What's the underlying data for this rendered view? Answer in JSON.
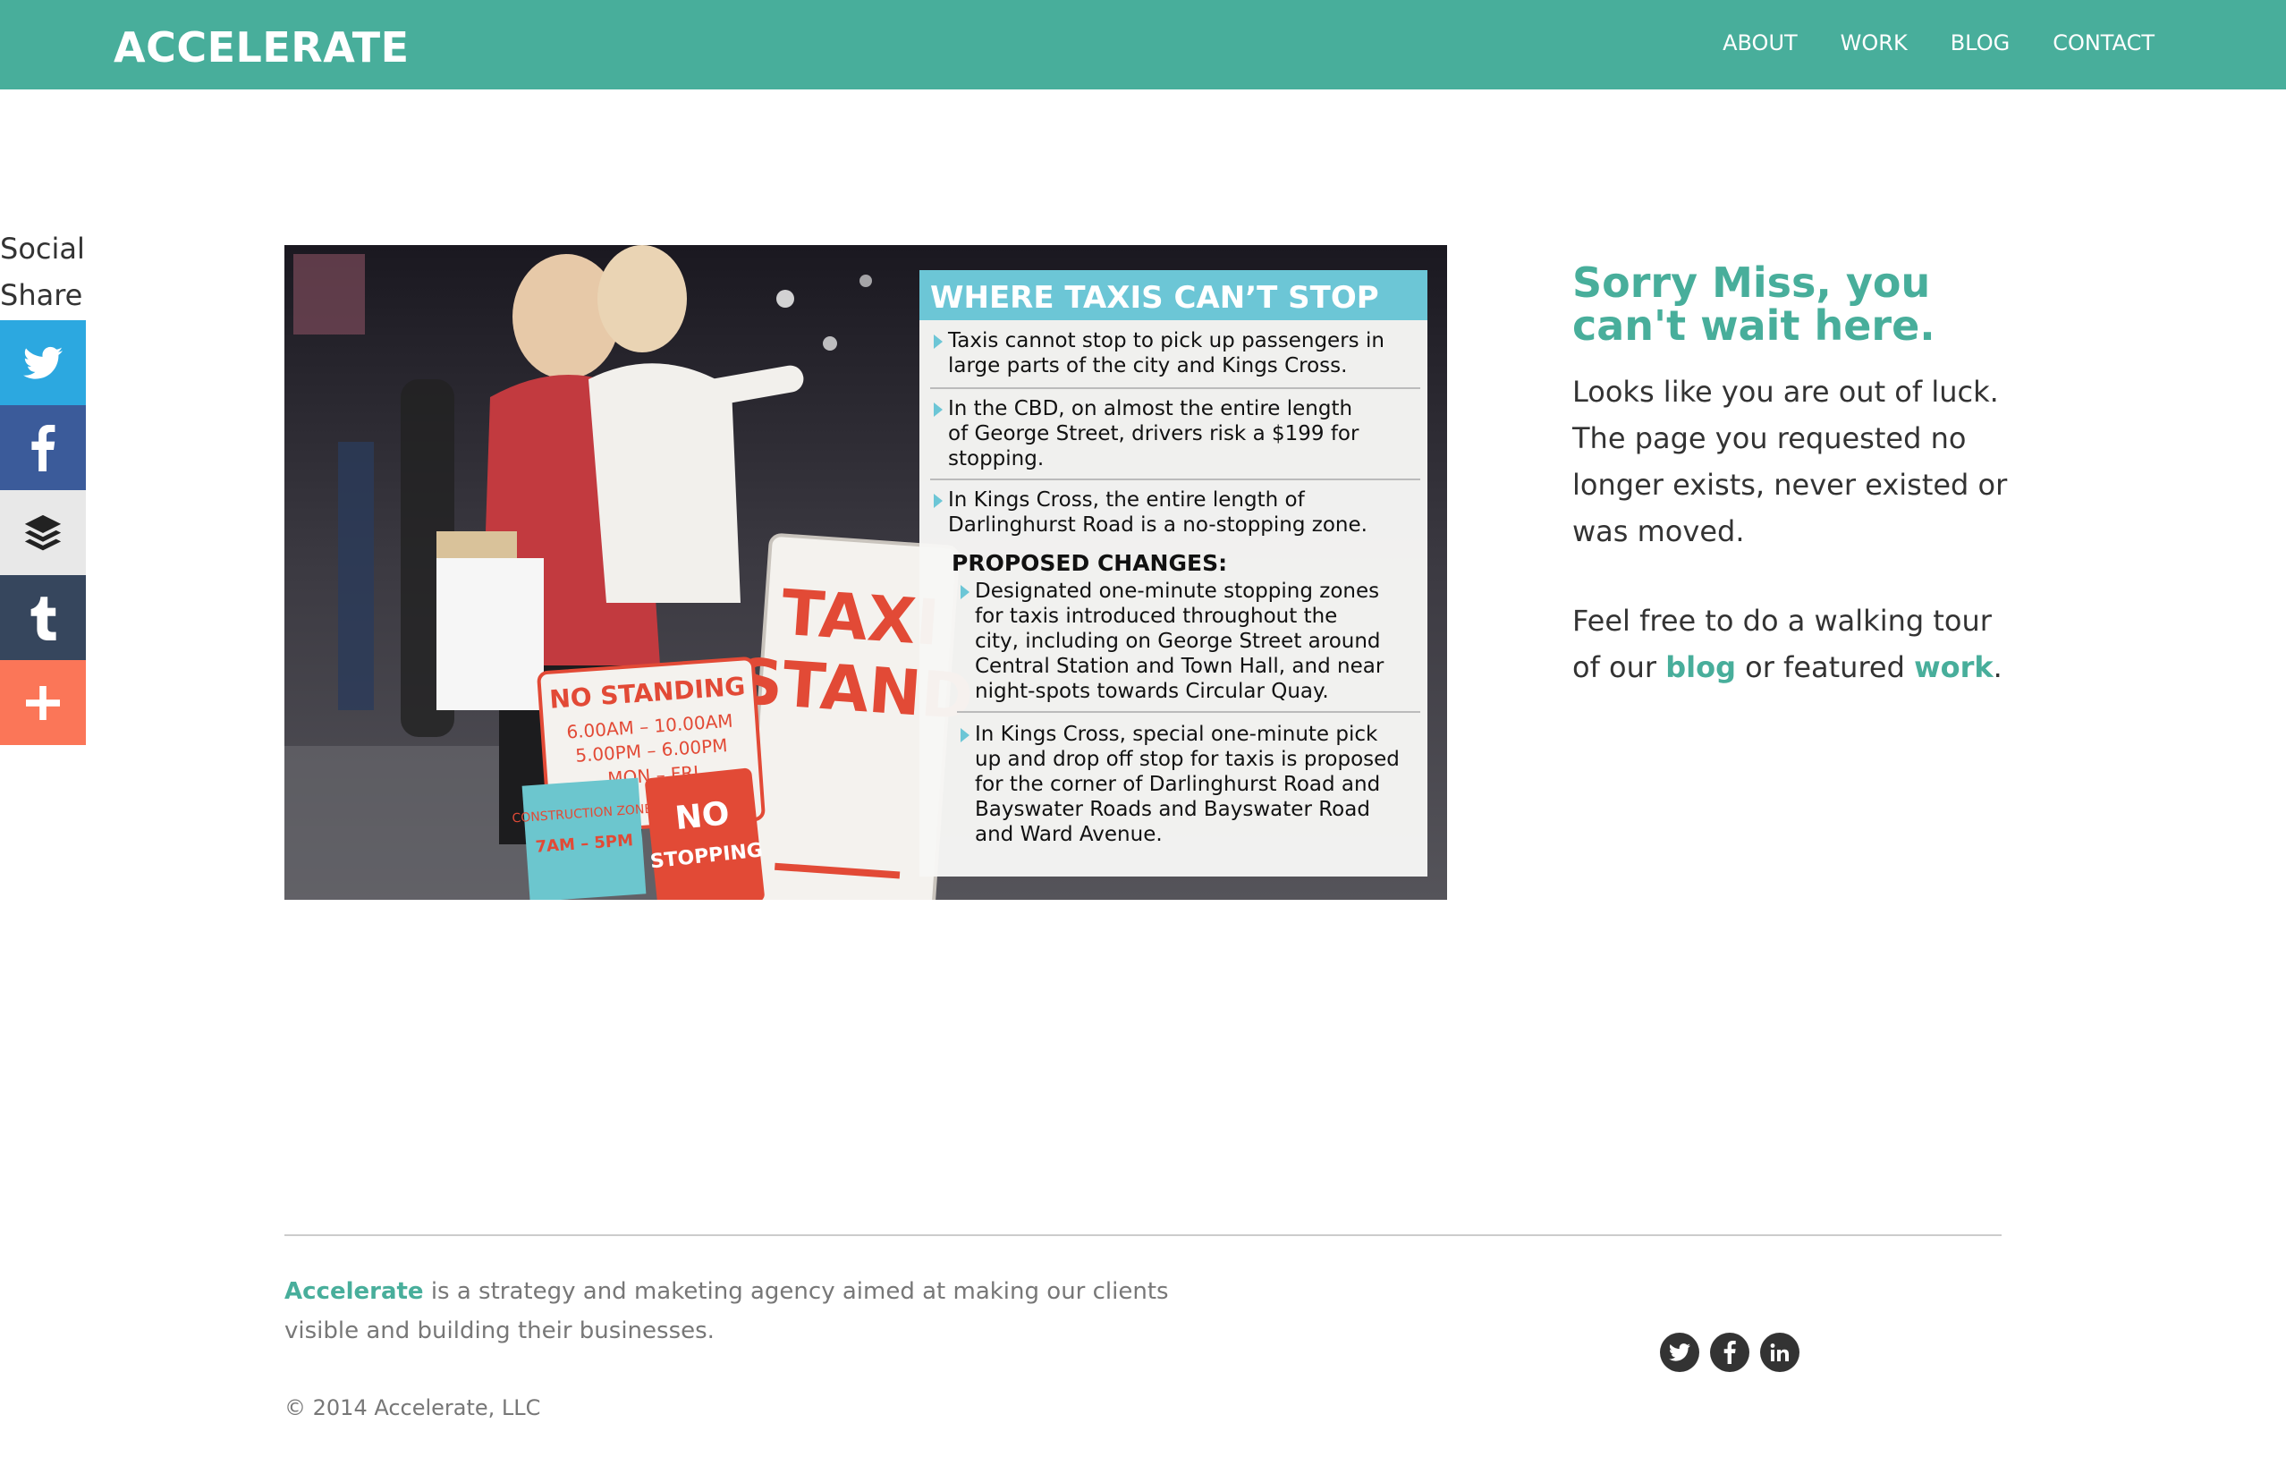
{
  "header": {
    "brand": "ACCELERATE",
    "nav": [
      "ABOUT",
      "WORK",
      "BLOG",
      "CONTACT"
    ]
  },
  "social": {
    "title_line1": "Social",
    "title_line2": "Share",
    "buttons": [
      {
        "icon": "twitter-icon",
        "color": "#2ca8e0"
      },
      {
        "icon": "facebook-icon",
        "color": "#3b5b9a"
      },
      {
        "icon": "buffer-icon",
        "color": "#e8e8e8"
      },
      {
        "icon": "tumblr-icon",
        "color": "#36465d"
      },
      {
        "icon": "plus-icon",
        "color": "#fb7658"
      }
    ]
  },
  "hero": {
    "graphic": {
      "heading": "WHERE TAXIS CAN’T STOP",
      "bullets": [
        "Taxis cannot stop to pick up passengers in large parts of the city and Kings Cross.",
        "In the CBD, on almost the entire length of George Street, drivers risk a $199 for stopping.",
        "In Kings Cross, the entire length of Darlinghurst Road is a no-stopping zone."
      ],
      "subheading": "PROPOSED CHANGES:",
      "changes": [
        "Designated one-minute stopping zones for taxis introduced throughout the city, including on George Street around Central Station and Town Hall, and near night-spots towards Circular Quay.",
        "In Kings Cross, special one-minute pick up and drop off stop for taxis is proposed for the corner of Darlinghurst Road and Bayswater Roads and Bayswater Road and Ward Avenue."
      ],
      "signs": {
        "taxi_1": "TAXI",
        "taxi_2": "STAND",
        "no_standing": "NO STANDING",
        "times_1": "6.00AM – 10.00AM",
        "times_2": "5.00PM – 6.00PM",
        "days": "MON – FRI",
        "construction": "CONSTRUCTION ZONE",
        "construction_time": "7AM – 5PM",
        "no_stopping_1": "NO",
        "no_stopping_2": "STOPPING"
      }
    }
  },
  "error": {
    "title": "Sorry Miss, you can't wait here.",
    "para1": "Looks like you are out of luck. The page you requested no longer exists, never existed or was moved.",
    "para2_prefix": "Feel free to do a walking tour of our ",
    "blog_link": "blog",
    "para2_mid": " or featured ",
    "work_link": "work",
    "para2_suffix": "."
  },
  "footer": {
    "brand": "Accelerate",
    "about": " is a strategy and maketing agency aimed at making our clients visible and building their businesses.",
    "copyright": "© 2014 Accelerate, LLC",
    "icons": [
      "twitter-icon",
      "facebook-icon",
      "linkedin-icon"
    ]
  }
}
